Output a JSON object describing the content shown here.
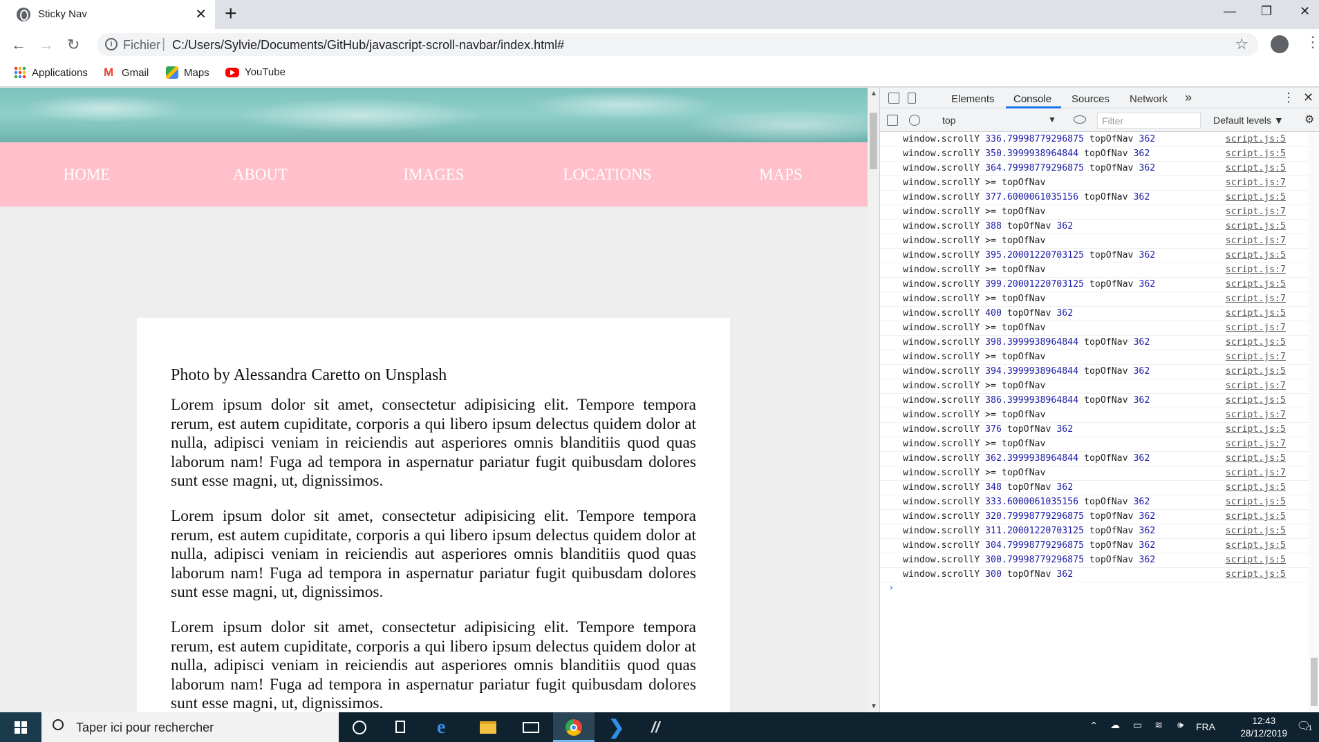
{
  "browser": {
    "tab_title": "Sticky Nav",
    "omnibox_scheme": "Fichier",
    "url": "C:/Users/Sylvie/Documents/GitHub/javascript-scroll-navbar/index.html#",
    "bookmarks": [
      {
        "label": "Applications",
        "icon": "apps-grid-icon"
      },
      {
        "label": "Gmail",
        "icon": "gmail-icon"
      },
      {
        "label": "Maps",
        "icon": "maps-icon"
      },
      {
        "label": "YouTube",
        "icon": "youtube-icon"
      }
    ]
  },
  "page": {
    "nav": [
      "HOME",
      "ABOUT",
      "IMAGES",
      "LOCATIONS",
      "MAPS"
    ],
    "caption": "Photo by Alessandra Caretto on Unsplash",
    "paragraphs": [
      "Lorem ipsum dolor sit amet, consectetur adipisicing elit. Tempore tempora rerum, est autem cupiditate, corporis a qui libero ipsum delectus quidem dolor at nulla, adipisci veniam in reiciendis aut asperiores omnis blanditiis quod quas laborum nam! Fuga ad tempora in aspernatur pariatur fugit quibusdam dolores sunt esse magni, ut, dignissimos.",
      "Lorem ipsum dolor sit amet, consectetur adipisicing elit. Tempore tempora rerum, est autem cupiditate, corporis a qui libero ipsum delectus quidem dolor at nulla, adipisci veniam in reiciendis aut asperiores omnis blanditiis quod quas laborum nam! Fuga ad tempora in aspernatur pariatur fugit quibusdam dolores sunt esse magni, ut, dignissimos.",
      "Lorem ipsum dolor sit amet, consectetur adipisicing elit. Tempore tempora rerum, est autem cupiditate, corporis a qui libero ipsum delectus quidem dolor at nulla, adipisci veniam in reiciendis aut asperiores omnis blanditiis quod quas laborum nam! Fuga ad tempora in aspernatur pariatur fugit quibusdam dolores sunt esse magni, ut, dignissimos."
    ],
    "nav_color": "#ffc0cb"
  },
  "devtools": {
    "tabs": [
      "Elements",
      "Console",
      "Sources",
      "Network"
    ],
    "active_tab": "Console",
    "more_tabs": "»",
    "context": "top",
    "filter_placeholder": "Filter",
    "levels": "Default levels ▼",
    "logs": [
      {
        "a": "window.scrollY ",
        "n1": "336.79998779296875",
        "b": " topOfNav ",
        "n2": "362",
        "src": "script.js:5"
      },
      {
        "a": "window.scrollY ",
        "n1": "350.3999938964844",
        "b": " topOfNav ",
        "n2": "362",
        "src": "script.js:5"
      },
      {
        "a": "window.scrollY ",
        "n1": "364.79998779296875",
        "b": " topOfNav ",
        "n2": "362",
        "src": "script.js:5"
      },
      {
        "a": "window.scrollY >= topOfNav",
        "n1": "",
        "b": "",
        "n2": "",
        "src": "script.js:7"
      },
      {
        "a": "window.scrollY ",
        "n1": "377.6000061035156",
        "b": " topOfNav ",
        "n2": "362",
        "src": "script.js:5"
      },
      {
        "a": "window.scrollY >= topOfNav",
        "n1": "",
        "b": "",
        "n2": "",
        "src": "script.js:7"
      },
      {
        "a": "window.scrollY ",
        "n1": "388",
        "b": " topOfNav ",
        "n2": "362",
        "src": "script.js:5"
      },
      {
        "a": "window.scrollY >= topOfNav",
        "n1": "",
        "b": "",
        "n2": "",
        "src": "script.js:7"
      },
      {
        "a": "window.scrollY ",
        "n1": "395.20001220703125",
        "b": " topOfNav ",
        "n2": "362",
        "src": "script.js:5"
      },
      {
        "a": "window.scrollY >= topOfNav",
        "n1": "",
        "b": "",
        "n2": "",
        "src": "script.js:7"
      },
      {
        "a": "window.scrollY ",
        "n1": "399.20001220703125",
        "b": " topOfNav ",
        "n2": "362",
        "src": "script.js:5"
      },
      {
        "a": "window.scrollY >= topOfNav",
        "n1": "",
        "b": "",
        "n2": "",
        "src": "script.js:7"
      },
      {
        "a": "window.scrollY ",
        "n1": "400",
        "b": " topOfNav ",
        "n2": "362",
        "src": "script.js:5"
      },
      {
        "a": "window.scrollY >= topOfNav",
        "n1": "",
        "b": "",
        "n2": "",
        "src": "script.js:7"
      },
      {
        "a": "window.scrollY ",
        "n1": "398.3999938964844",
        "b": " topOfNav ",
        "n2": "362",
        "src": "script.js:5"
      },
      {
        "a": "window.scrollY >= topOfNav",
        "n1": "",
        "b": "",
        "n2": "",
        "src": "script.js:7"
      },
      {
        "a": "window.scrollY ",
        "n1": "394.3999938964844",
        "b": " topOfNav ",
        "n2": "362",
        "src": "script.js:5"
      },
      {
        "a": "window.scrollY >= topOfNav",
        "n1": "",
        "b": "",
        "n2": "",
        "src": "script.js:7"
      },
      {
        "a": "window.scrollY ",
        "n1": "386.3999938964844",
        "b": " topOfNav ",
        "n2": "362",
        "src": "script.js:5"
      },
      {
        "a": "window.scrollY >= topOfNav",
        "n1": "",
        "b": "",
        "n2": "",
        "src": "script.js:7"
      },
      {
        "a": "window.scrollY ",
        "n1": "376",
        "b": " topOfNav ",
        "n2": "362",
        "src": "script.js:5"
      },
      {
        "a": "window.scrollY >= topOfNav",
        "n1": "",
        "b": "",
        "n2": "",
        "src": "script.js:7"
      },
      {
        "a": "window.scrollY ",
        "n1": "362.3999938964844",
        "b": " topOfNav ",
        "n2": "362",
        "src": "script.js:5"
      },
      {
        "a": "window.scrollY >= topOfNav",
        "n1": "",
        "b": "",
        "n2": "",
        "src": "script.js:7"
      },
      {
        "a": "window.scrollY ",
        "n1": "348",
        "b": " topOfNav ",
        "n2": "362",
        "src": "script.js:5"
      },
      {
        "a": "window.scrollY ",
        "n1": "333.6000061035156",
        "b": " topOfNav ",
        "n2": "362",
        "src": "script.js:5"
      },
      {
        "a": "window.scrollY ",
        "n1": "320.79998779296875",
        "b": " topOfNav ",
        "n2": "362",
        "src": "script.js:5"
      },
      {
        "a": "window.scrollY ",
        "n1": "311.20001220703125",
        "b": " topOfNav ",
        "n2": "362",
        "src": "script.js:5"
      },
      {
        "a": "window.scrollY ",
        "n1": "304.79998779296875",
        "b": " topOfNav ",
        "n2": "362",
        "src": "script.js:5"
      },
      {
        "a": "window.scrollY ",
        "n1": "300.79998779296875",
        "b": " topOfNav ",
        "n2": "362",
        "src": "script.js:5"
      },
      {
        "a": "window.scrollY ",
        "n1": "300",
        "b": " topOfNav ",
        "n2": "362",
        "src": "script.js:5"
      }
    ],
    "prompt": "›"
  },
  "taskbar": {
    "search_placeholder": "Taper ici pour rechercher",
    "language": "FRA",
    "time": "12:43",
    "date": "28/12/2019",
    "notifications": "1",
    "apps": [
      "cortana-circle-icon",
      "task-view-icon",
      "edge-icon",
      "file-explorer-icon",
      "mail-icon",
      "chrome-icon",
      "vscode-icon",
      "sublime-like-icon"
    ],
    "active_app": "chrome-icon"
  }
}
